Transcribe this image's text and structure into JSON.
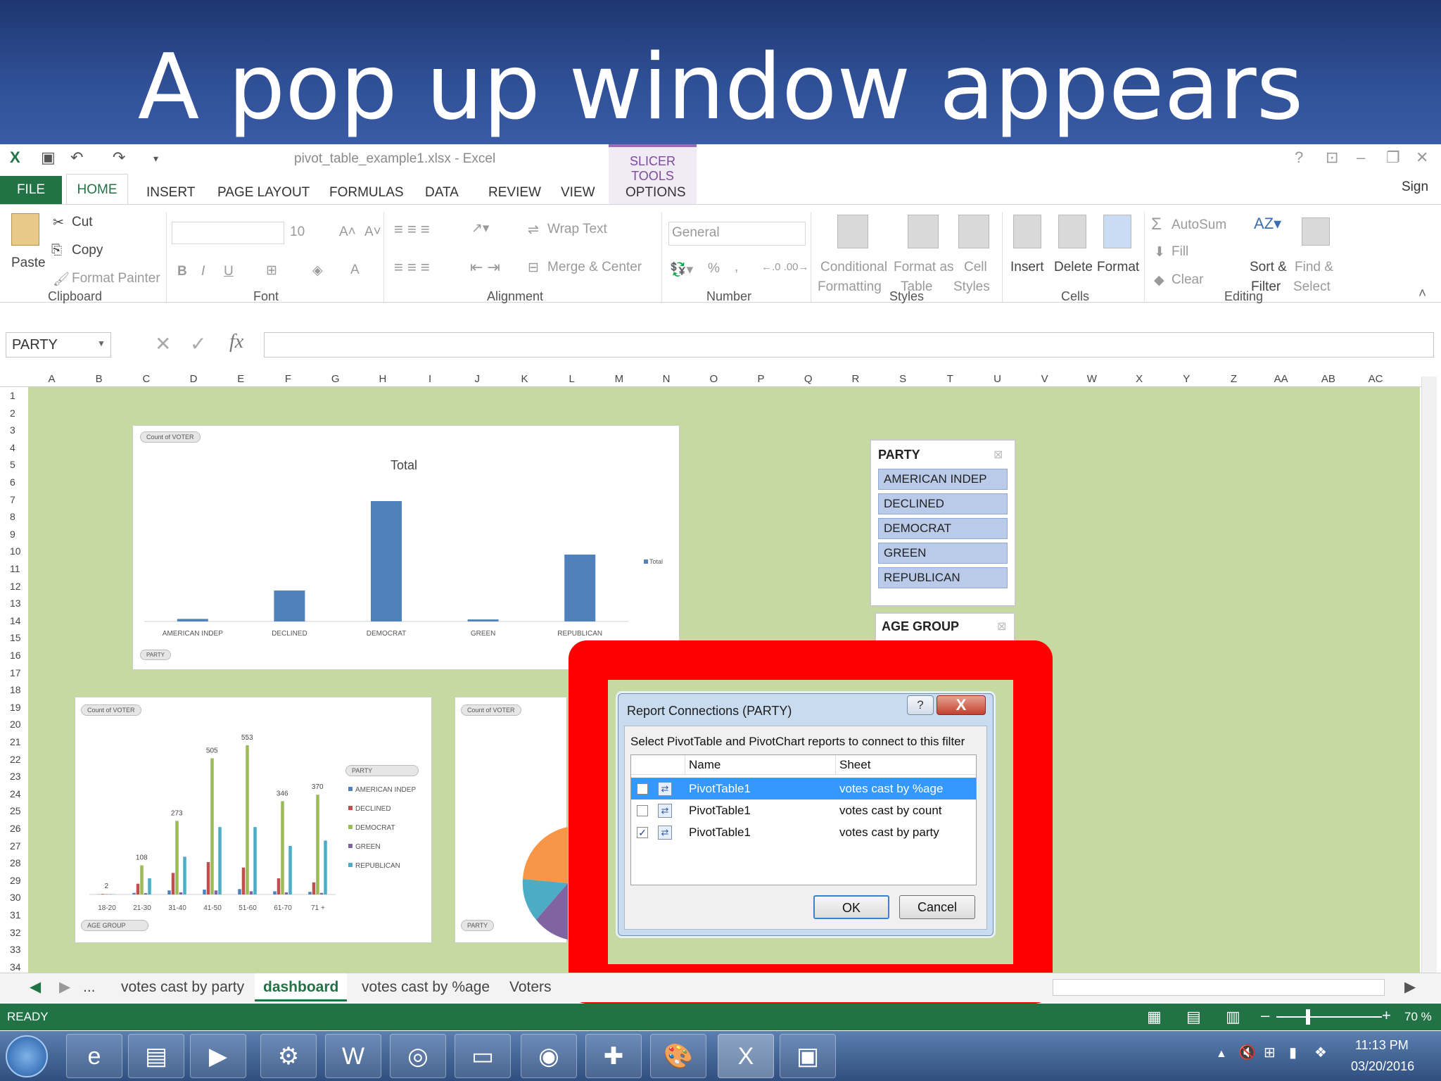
{
  "slide": {
    "title": "A pop up window appears"
  },
  "excel": {
    "doc_title": "pivot_table_example1.xlsx - Excel",
    "slicer_tools": "SLICER TOOLS",
    "tabs": [
      "FILE",
      "HOME",
      "INSERT",
      "PAGE LAYOUT",
      "FORMULAS",
      "DATA",
      "REVIEW",
      "VIEW",
      "OPTIONS"
    ],
    "sign_in": "Sign in",
    "ribbon": {
      "clipboard": {
        "label": "Clipboard",
        "paste": "Paste",
        "cut": "Cut",
        "copy": "Copy",
        "format_painter": "Format Painter"
      },
      "font": {
        "label": "Font",
        "size": "10",
        "bold": "B",
        "italic": "I",
        "underline": "U"
      },
      "alignment": {
        "label": "Alignment",
        "wrap": "Wrap Text",
        "merge": "Merge & Center"
      },
      "number": {
        "label": "Number",
        "format": "General",
        "percent": "%"
      },
      "styles": {
        "label": "Styles",
        "conditional_1": "Conditional",
        "conditional_2": "Formatting",
        "format_table_1": "Format as",
        "format_table_2": "Table",
        "cell_styles_1": "Cell",
        "cell_styles_2": "Styles"
      },
      "cells": {
        "label": "Cells",
        "insert": "Insert",
        "delete": "Delete",
        "format": "Format"
      },
      "editing": {
        "label": "Editing",
        "autosum": "AutoSum",
        "fill": "Fill",
        "clear": "Clear",
        "sort_1": "Sort &",
        "sort_2": "Filter",
        "find_1": "Find &",
        "find_2": "Select"
      }
    },
    "name_box": "PARTY",
    "columns": [
      "A",
      "B",
      "C",
      "D",
      "E",
      "F",
      "G",
      "H",
      "I",
      "J",
      "K",
      "L",
      "M",
      "N",
      "O",
      "P",
      "Q",
      "R",
      "S",
      "T",
      "U",
      "V",
      "W",
      "X",
      "Y",
      "Z",
      "AA",
      "AB",
      "AC"
    ],
    "rows": [
      "1",
      "2",
      "3",
      "4",
      "5",
      "6",
      "7",
      "8",
      "9",
      "10",
      "11",
      "12",
      "13",
      "14",
      "15",
      "16",
      "17",
      "18",
      "19",
      "20",
      "21",
      "22",
      "23",
      "24",
      "25",
      "26",
      "27",
      "28",
      "29",
      "30",
      "31",
      "32",
      "33",
      "34"
    ],
    "sheet_tabs": [
      "...",
      "votes cast by party",
      "dashboard",
      "votes cast by %age",
      "Voters"
    ],
    "status": {
      "ready": "READY",
      "zoom": "70 %"
    }
  },
  "chart_data": [
    {
      "type": "bar",
      "title": "Total",
      "categories": [
        "AMERICAN INDEP",
        "DECLINED",
        "DEMOCRAT",
        "GREEN",
        "REPUBLICAN"
      ],
      "series": [
        {
          "name": "Total",
          "values": [
            15,
            185,
            720,
            12,
            400
          ]
        }
      ],
      "ylim": [
        0,
        800
      ],
      "field_button": "Count of VOTER",
      "axis_button": "PARTY",
      "legend": "right",
      "color": "#4f81bd"
    },
    {
      "type": "bar",
      "categories": [
        "18-20",
        "21-30",
        "31-40",
        "41-50",
        "51-60",
        "61-70",
        "71 +"
      ],
      "series": [
        {
          "name": "AMERICAN INDEP",
          "values": [
            1,
            6,
            15,
            18,
            20,
            12,
            10
          ]
        },
        {
          "name": "DECLINED",
          "values": [
            2,
            40,
            80,
            120,
            100,
            60,
            45
          ]
        },
        {
          "name": "DEMOCRAT",
          "values": [
            2,
            108,
            273,
            505,
            553,
            346,
            370
          ]
        },
        {
          "name": "GREEN",
          "values": [
            1,
            5,
            8,
            15,
            12,
            8,
            6
          ]
        },
        {
          "name": "REPUBLICAN",
          "values": [
            1,
            60,
            140,
            250,
            250,
            180,
            200
          ]
        }
      ],
      "data_labels": [
        "2",
        "108",
        "273",
        "505",
        "553",
        "346",
        "370"
      ],
      "ylim": [
        0,
        600
      ],
      "field_button": "Count of VOTER",
      "axis_button": "AGE GROUP",
      "legend_button": "PARTY",
      "legend": "right",
      "colors": [
        "#4f81bd",
        "#c0504d",
        "#9bbb59",
        "#8064a2",
        "#4bacc6"
      ]
    }
  ],
  "slicers": {
    "party": {
      "title": "PARTY",
      "items": [
        "AMERICAN INDEP",
        "DECLINED",
        "DEMOCRAT",
        "GREEN",
        "REPUBLICAN"
      ]
    },
    "age": {
      "title": "AGE GROUP"
    }
  },
  "pie_chart": {
    "field_button": "Count of VOTER",
    "axis_button": "PARTY"
  },
  "dialog": {
    "title": "Report Connections (PARTY)",
    "help": "?",
    "close": "X",
    "instruction": "Select PivotTable and PivotChart reports to connect to this filter",
    "columns": [
      "Name",
      "Sheet"
    ],
    "rows": [
      {
        "name": "PivotTable1",
        "sheet": "votes cast by %age",
        "checked": false,
        "selected": true
      },
      {
        "name": "PivotTable1",
        "sheet": "votes cast by count",
        "checked": false,
        "selected": false
      },
      {
        "name": "PivotTable1",
        "sheet": "votes cast by party",
        "checked": true,
        "selected": false
      }
    ],
    "ok": "OK",
    "cancel": "Cancel"
  },
  "taskbar": {
    "time": "11:13 PM",
    "date": "03/20/2016"
  }
}
